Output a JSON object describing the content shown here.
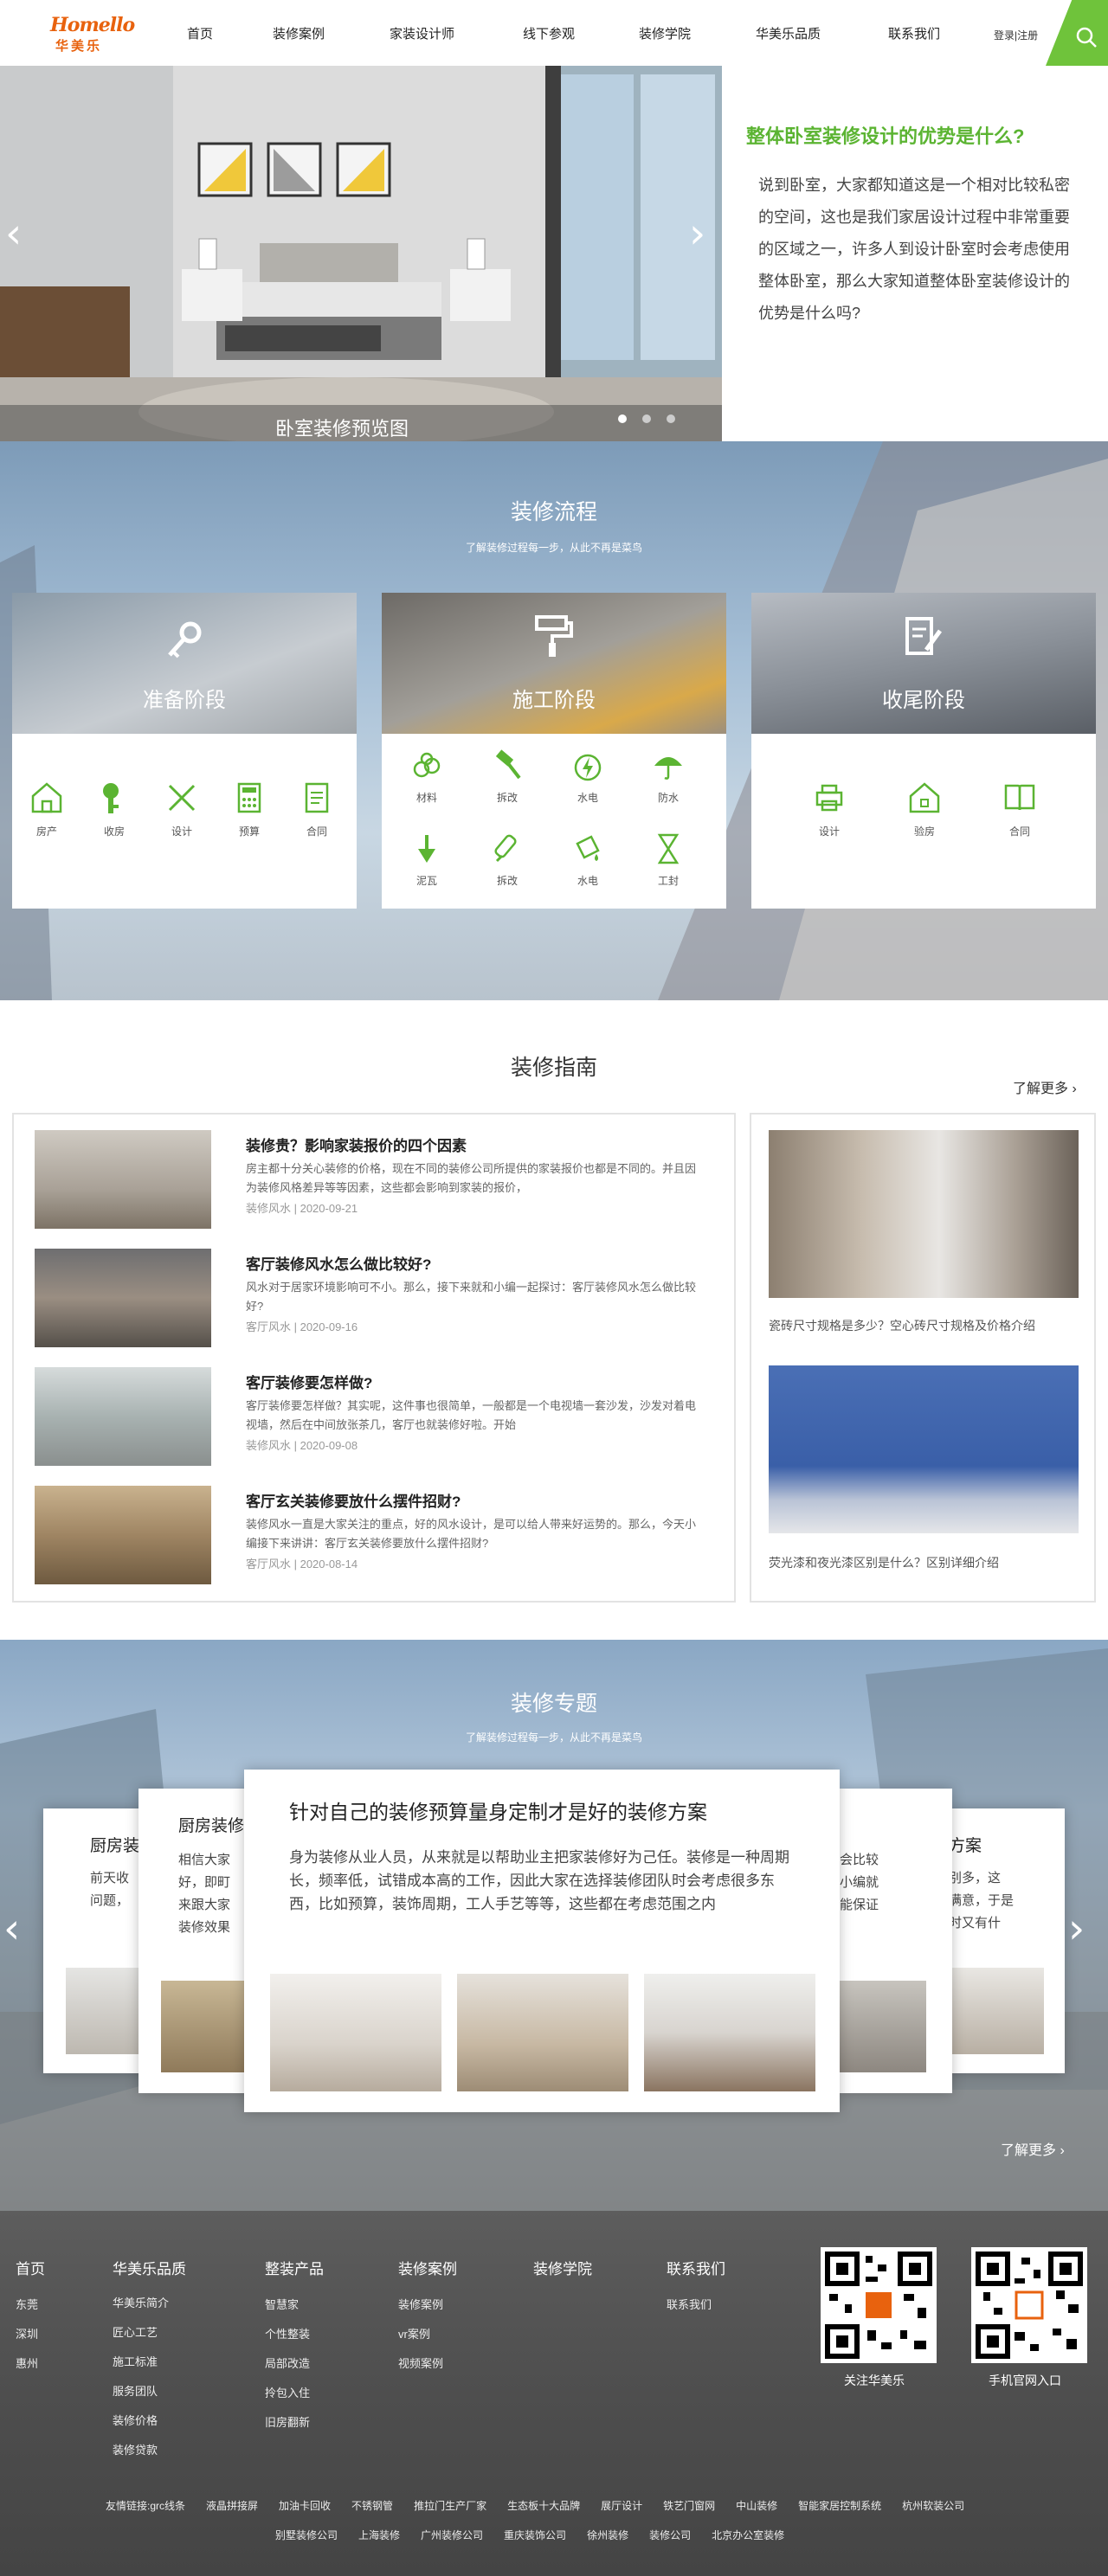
{
  "header": {
    "logo_en": "Homello",
    "logo_cn": "华美乐",
    "nav": [
      "首页",
      "装修案例",
      "家装设计师",
      "线下参观",
      "装修学院",
      "华美乐品质",
      "联系我们"
    ],
    "login": "登录|注册",
    "accent": "#6fc33b"
  },
  "hero": {
    "caption": "卧室装修预览图",
    "intro_title": "整体卧室装修设计的优势是什么?",
    "intro_text": "说到卧室，大家都知道这是一个相对比较私密的空间，这也是我们家居设计过程中非常重要的区域之一，许多人到设计卧室时会考虑使用整体卧室，那么大家知道整体卧室装修设计的优势是什么吗?"
  },
  "process": {
    "title": "装修流程",
    "subtitle": "了解装修过程每一步，从此不再是菜鸟",
    "stages": [
      {
        "title": "准备阶段",
        "items": [
          "房产",
          "收房",
          "设计",
          "预算",
          "合同"
        ]
      },
      {
        "title": "施工阶段",
        "items": [
          "材料",
          "拆改",
          "水电",
          "防水",
          "泥瓦",
          "拆改",
          "水电",
          "工封"
        ]
      },
      {
        "title": "收尾阶段",
        "items": [
          "设计",
          "验房",
          "合同"
        ]
      }
    ]
  },
  "guide": {
    "title": "装修指南",
    "more": "了解更多",
    "articles": [
      {
        "title": "装修贵？影响家装报价的四个因素",
        "text": "房主都十分关心装修的价格，现在不同的装修公司所提供的家装报价也都是不同的。并且因为装修风格差异等等因素，这些都会影响到家装的报价，",
        "meta": "装修风水 | 2020-09-21"
      },
      {
        "title": "客厅装修风水怎么做比较好?",
        "text": "风水对于居家环境影响可不小。那么，接下来就和小编一起探讨：客厅装修风水怎么做比较好?",
        "meta": "客厅风水 | 2020-09-16"
      },
      {
        "title": "客厅装修要怎样做?",
        "text": "客厅装修要怎样做？其实呢，这件事也很简单，一般都是一个电视墙一套沙发，沙发对着电视墙，然后在中间放张茶几，客厅也就装修好啦。开始",
        "meta": "装修风水 | 2020-09-08"
      },
      {
        "title": "客厅玄关装修要放什么摆件招财?",
        "text": "装修风水一直是大家关注的重点，好的风水设计，是可以给人带来好运势的。那么，今天小编接下来讲讲：客厅玄关装修要放什么摆件招财?",
        "meta": "客厅风水 | 2020-08-14"
      }
    ],
    "side": [
      {
        "caption": "瓷砖尺寸规格是多少？空心砖尺寸规格及价格介绍"
      },
      {
        "caption": "荧光漆和夜光漆区别是什么？区别详细介绍"
      }
    ]
  },
  "topics": {
    "title": "装修专题",
    "subtitle": "了解装修过程每一步，从此不再是菜鸟",
    "more": "了解更多",
    "main_title": "针对自己的装修预算量身定制才是好的装修方案",
    "main_text": "身为装修从业人员，从来就是以帮助业主把家装修好为己任。装修是一种周期长，频率低，试错成本高的工作，因此大家在选择装修团队时会考虑很多东西，比如预算，装饰周期，工人手艺等等，这些都在考虑范围之内",
    "side_left_1_title": "厨房装",
    "side_left_1_text": "前天收\n问题，",
    "side_left_2_title": "厨房装修",
    "side_left_2_text": "相信大家\n好，即町\n来跟大家\n装修效果",
    "side_right_1_title": "方案",
    "side_right_1_text": "别多，这\n满意，于是\n时又有什",
    "side_right_2_text": "会比较\n小编就\n能保证"
  },
  "footer": {
    "cols": [
      {
        "head": "首页",
        "items": [
          "东莞",
          "深圳",
          "惠州"
        ]
      },
      {
        "head": "华美乐品质",
        "items": [
          "华美乐简介",
          "匠心工艺",
          "施工标准",
          "服务团队",
          "装修价格",
          "装修贷款"
        ]
      },
      {
        "head": "整装产品",
        "items": [
          "智慧家",
          "个性整装",
          "局部改造",
          "拎包入住",
          "旧房翻新"
        ]
      },
      {
        "head": "装修案例",
        "items": [
          "装修案例",
          "vr案例",
          "视频案例"
        ]
      },
      {
        "head": "装修学院",
        "items": []
      },
      {
        "head": "联系我们",
        "items": [
          "联系我们"
        ]
      }
    ],
    "qr_captions": [
      "关注华美乐",
      "手机官网入口"
    ],
    "links_row1": [
      "友情链接:grc线条",
      "液晶拼接屏",
      "加油卡回收",
      "不锈钢管",
      "推拉门生产厂家",
      "生态板十大品牌",
      "展厅设计",
      "铁艺门窗网",
      "中山装修",
      "智能家居控制系统",
      "杭州软装公司"
    ],
    "links_row2": [
      "别墅装修公司",
      "上海装修",
      "广州装修公司",
      "重庆装饰公司",
      "徐州装修",
      "装修公司",
      "北京办公室装修"
    ]
  }
}
